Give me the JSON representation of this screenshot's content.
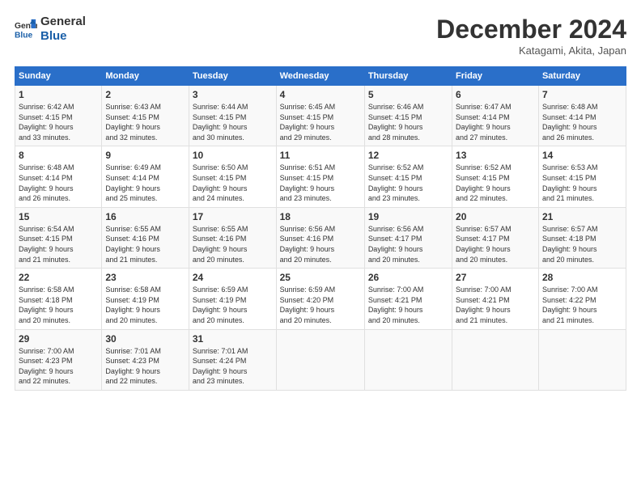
{
  "header": {
    "logo_line1": "General",
    "logo_line2": "Blue",
    "month": "December 2024",
    "location": "Katagami, Akita, Japan"
  },
  "weekdays": [
    "Sunday",
    "Monday",
    "Tuesday",
    "Wednesday",
    "Thursday",
    "Friday",
    "Saturday"
  ],
  "weeks": [
    [
      {
        "day": "1",
        "info": "Sunrise: 6:42 AM\nSunset: 4:15 PM\nDaylight: 9 hours\nand 33 minutes."
      },
      {
        "day": "2",
        "info": "Sunrise: 6:43 AM\nSunset: 4:15 PM\nDaylight: 9 hours\nand 32 minutes."
      },
      {
        "day": "3",
        "info": "Sunrise: 6:44 AM\nSunset: 4:15 PM\nDaylight: 9 hours\nand 30 minutes."
      },
      {
        "day": "4",
        "info": "Sunrise: 6:45 AM\nSunset: 4:15 PM\nDaylight: 9 hours\nand 29 minutes."
      },
      {
        "day": "5",
        "info": "Sunrise: 6:46 AM\nSunset: 4:15 PM\nDaylight: 9 hours\nand 28 minutes."
      },
      {
        "day": "6",
        "info": "Sunrise: 6:47 AM\nSunset: 4:14 PM\nDaylight: 9 hours\nand 27 minutes."
      },
      {
        "day": "7",
        "info": "Sunrise: 6:48 AM\nSunset: 4:14 PM\nDaylight: 9 hours\nand 26 minutes."
      }
    ],
    [
      {
        "day": "8",
        "info": "Sunrise: 6:48 AM\nSunset: 4:14 PM\nDaylight: 9 hours\nand 26 minutes."
      },
      {
        "day": "9",
        "info": "Sunrise: 6:49 AM\nSunset: 4:14 PM\nDaylight: 9 hours\nand 25 minutes."
      },
      {
        "day": "10",
        "info": "Sunrise: 6:50 AM\nSunset: 4:15 PM\nDaylight: 9 hours\nand 24 minutes."
      },
      {
        "day": "11",
        "info": "Sunrise: 6:51 AM\nSunset: 4:15 PM\nDaylight: 9 hours\nand 23 minutes."
      },
      {
        "day": "12",
        "info": "Sunrise: 6:52 AM\nSunset: 4:15 PM\nDaylight: 9 hours\nand 23 minutes."
      },
      {
        "day": "13",
        "info": "Sunrise: 6:52 AM\nSunset: 4:15 PM\nDaylight: 9 hours\nand 22 minutes."
      },
      {
        "day": "14",
        "info": "Sunrise: 6:53 AM\nSunset: 4:15 PM\nDaylight: 9 hours\nand 21 minutes."
      }
    ],
    [
      {
        "day": "15",
        "info": "Sunrise: 6:54 AM\nSunset: 4:15 PM\nDaylight: 9 hours\nand 21 minutes."
      },
      {
        "day": "16",
        "info": "Sunrise: 6:55 AM\nSunset: 4:16 PM\nDaylight: 9 hours\nand 21 minutes."
      },
      {
        "day": "17",
        "info": "Sunrise: 6:55 AM\nSunset: 4:16 PM\nDaylight: 9 hours\nand 20 minutes."
      },
      {
        "day": "18",
        "info": "Sunrise: 6:56 AM\nSunset: 4:16 PM\nDaylight: 9 hours\nand 20 minutes."
      },
      {
        "day": "19",
        "info": "Sunrise: 6:56 AM\nSunset: 4:17 PM\nDaylight: 9 hours\nand 20 minutes."
      },
      {
        "day": "20",
        "info": "Sunrise: 6:57 AM\nSunset: 4:17 PM\nDaylight: 9 hours\nand 20 minutes."
      },
      {
        "day": "21",
        "info": "Sunrise: 6:57 AM\nSunset: 4:18 PM\nDaylight: 9 hours\nand 20 minutes."
      }
    ],
    [
      {
        "day": "22",
        "info": "Sunrise: 6:58 AM\nSunset: 4:18 PM\nDaylight: 9 hours\nand 20 minutes."
      },
      {
        "day": "23",
        "info": "Sunrise: 6:58 AM\nSunset: 4:19 PM\nDaylight: 9 hours\nand 20 minutes."
      },
      {
        "day": "24",
        "info": "Sunrise: 6:59 AM\nSunset: 4:19 PM\nDaylight: 9 hours\nand 20 minutes."
      },
      {
        "day": "25",
        "info": "Sunrise: 6:59 AM\nSunset: 4:20 PM\nDaylight: 9 hours\nand 20 minutes."
      },
      {
        "day": "26",
        "info": "Sunrise: 7:00 AM\nSunset: 4:21 PM\nDaylight: 9 hours\nand 20 minutes."
      },
      {
        "day": "27",
        "info": "Sunrise: 7:00 AM\nSunset: 4:21 PM\nDaylight: 9 hours\nand 21 minutes."
      },
      {
        "day": "28",
        "info": "Sunrise: 7:00 AM\nSunset: 4:22 PM\nDaylight: 9 hours\nand 21 minutes."
      }
    ],
    [
      {
        "day": "29",
        "info": "Sunrise: 7:00 AM\nSunset: 4:23 PM\nDaylight: 9 hours\nand 22 minutes."
      },
      {
        "day": "30",
        "info": "Sunrise: 7:01 AM\nSunset: 4:23 PM\nDaylight: 9 hours\nand 22 minutes."
      },
      {
        "day": "31",
        "info": "Sunrise: 7:01 AM\nSunset: 4:24 PM\nDaylight: 9 hours\nand 23 minutes."
      },
      {
        "day": "",
        "info": ""
      },
      {
        "day": "",
        "info": ""
      },
      {
        "day": "",
        "info": ""
      },
      {
        "day": "",
        "info": ""
      }
    ]
  ]
}
